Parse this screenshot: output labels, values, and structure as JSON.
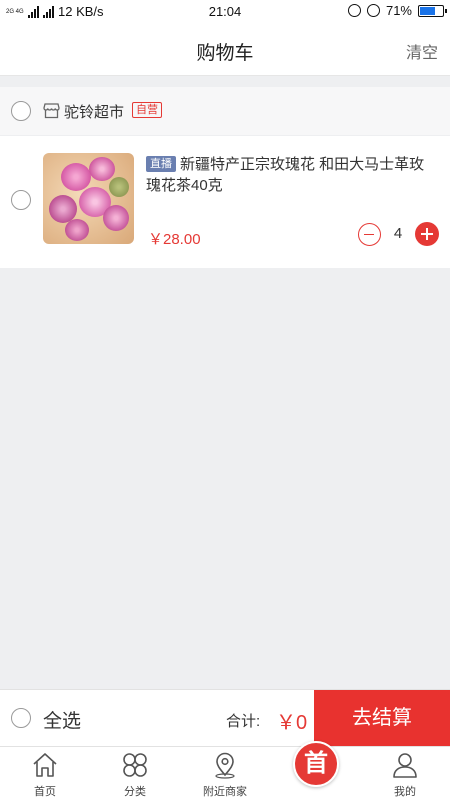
{
  "status_bar": {
    "network_small": "2G 4G",
    "speed": "12 KB/s",
    "time": "21:04",
    "battery": "71%",
    "battery_level": 0.71,
    "battery_color": "#1a73e8"
  },
  "header": {
    "title": "购物车",
    "clear_label": "清空"
  },
  "store": {
    "name": "驼铃超市",
    "badge": "自营",
    "icon": "store-icon"
  },
  "cart_items": [
    {
      "live_badge": "直播",
      "title": "新疆特产正宗玫瑰花 和田大马士革玫瑰花茶40克",
      "price": "￥28.00",
      "quantity": "4",
      "selected": false
    }
  ],
  "checkout": {
    "select_all_label": "全选",
    "total_label": "合计:",
    "total_value": "￥0",
    "checkout_label": "去结算"
  },
  "tabs": [
    {
      "label": "首页",
      "icon": "home-icon"
    },
    {
      "label": "分类",
      "icon": "category-icon"
    },
    {
      "label": "附近商家",
      "icon": "location-icon"
    },
    {
      "label": "首",
      "icon": "brand-logo-icon"
    },
    {
      "label": "我的",
      "icon": "user-icon"
    }
  ],
  "colors": {
    "accent": "#e53935",
    "checkout_button": "#e8322f",
    "live_badge": "#6a7fb0",
    "page_bg": "#eeeff1"
  }
}
